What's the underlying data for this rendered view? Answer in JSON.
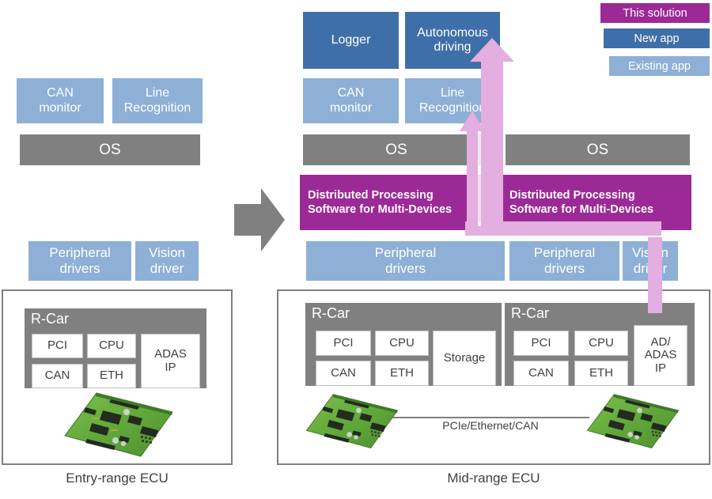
{
  "legend": {
    "items": [
      {
        "label": "This solution",
        "color": "#9c2a96"
      },
      {
        "label": "New app",
        "color": "#3f6fa8"
      },
      {
        "label": "Existing app",
        "color": "#8eb0d6"
      }
    ]
  },
  "left_system": {
    "caption": "Entry-range ECU",
    "apps": [
      {
        "label": "CAN\nmonitor",
        "kind": "existing"
      },
      {
        "label": "Line\nRecognition",
        "kind": "existing"
      }
    ],
    "os": "OS",
    "drivers": [
      {
        "label": "Peripheral\ndrivers"
      },
      {
        "label": "Vision\ndriver"
      }
    ],
    "soc": {
      "title": "R-Car",
      "chips": [
        "PCI",
        "CPU",
        "CAN",
        "ETH"
      ],
      "accelerator": "ADAS\nIP"
    }
  },
  "right_system": {
    "caption": "Mid-range ECU",
    "apps_new": [
      {
        "label": "Logger"
      },
      {
        "label": "Autonomous\ndriving"
      }
    ],
    "apps_existing": [
      {
        "label": "CAN\nmonitor"
      },
      {
        "label": "Line\nRecognition"
      }
    ],
    "os_left": "OS",
    "os_right": "OS",
    "dps_left": "Distributed Processing\nSoftware for Multi-Devices",
    "dps_right": "Distributed Processing\nSoftware for Multi-Devices",
    "drivers": [
      {
        "label": "Peripheral\ndrivers"
      },
      {
        "label": "Peripheral\ndrivers"
      },
      {
        "label": "Vision\ndriver"
      }
    ],
    "soc_left": {
      "title": "R-Car",
      "chips": [
        "PCI",
        "CPU",
        "CAN",
        "ETH"
      ],
      "accelerator": "Storage"
    },
    "soc_right": {
      "title": "R-Car",
      "chips": [
        "PCI",
        "CPU",
        "CAN",
        "ETH"
      ],
      "accelerator": "AD/\nADAS\nIP"
    },
    "interconnect_label": "PCIe/Ethernet/CAN"
  },
  "transition_arrow": {
    "name": "right-arrow",
    "color": "#808080"
  },
  "flow_arrow": {
    "color": "#e3aee0",
    "edge": "#d99ad6"
  },
  "colors": {
    "existing_app": "#8eb0d6",
    "new_app": "#3f6fa8",
    "this_solution": "#9c2a96",
    "os": "#808080",
    "chip_border": "#bfbfbf",
    "text": "#404040"
  }
}
